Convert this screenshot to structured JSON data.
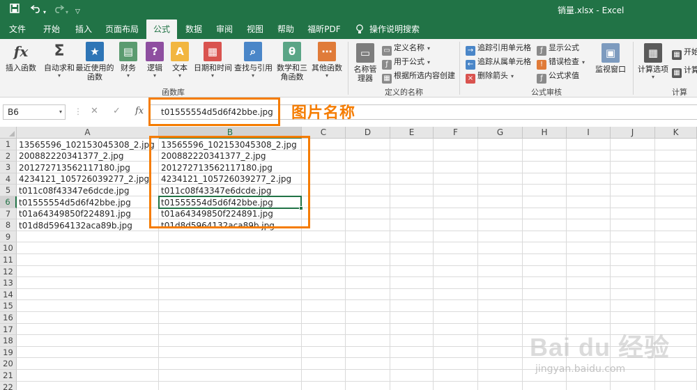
{
  "title_bar": {
    "document_title": "销量.xlsx  -  Excel",
    "save_icon": "save-icon",
    "undo_icon": "undo-icon",
    "redo_icon": "redo-icon",
    "customize_icon": "customize-toolbar-icon",
    "brand_color": "#217346"
  },
  "tabs": [
    {
      "label": "文件"
    },
    {
      "label": "开始"
    },
    {
      "label": "插入"
    },
    {
      "label": "页面布局"
    },
    {
      "label": "公式"
    },
    {
      "label": "数据"
    },
    {
      "label": "审阅"
    },
    {
      "label": "视图"
    },
    {
      "label": "帮助"
    },
    {
      "label": "福昕PDF"
    },
    {
      "label": "操作说明搜索"
    }
  ],
  "active_tab": "公式",
  "ribbon": {
    "function_library": {
      "label": "函数库",
      "buttons": [
        {
          "label": "插入函数",
          "icon": "fx-icon"
        },
        {
          "label": "自动求和",
          "icon": "sigma-icon"
        },
        {
          "label": "最近使用的函数",
          "icon": "star-book-icon"
        },
        {
          "label": "财务",
          "icon": "finance-book-icon"
        },
        {
          "label": "逻辑",
          "icon": "logic-book-icon"
        },
        {
          "label": "文本",
          "icon": "text-book-icon"
        },
        {
          "label": "日期和时间",
          "icon": "date-time-book-icon"
        },
        {
          "label": "查找与引用",
          "icon": "lookup-book-icon"
        },
        {
          "label": "数学和三角函数",
          "icon": "math-book-icon"
        },
        {
          "label": "其他函数",
          "icon": "more-functions-book-icon"
        }
      ]
    },
    "defined_names": {
      "label": "定义的名称",
      "name_manager": "名称管理器",
      "items": [
        {
          "label": "定义名称"
        },
        {
          "label": "用于公式"
        },
        {
          "label": "根据所选内容创建"
        }
      ]
    },
    "formula_auditing": {
      "label": "公式审核",
      "items": [
        {
          "label": "追踪引用单元格"
        },
        {
          "label": "显示公式"
        },
        {
          "label": "追踪从属单元格"
        },
        {
          "label": "错误检查"
        },
        {
          "label": "删除箭头"
        },
        {
          "label": "公式求值"
        }
      ],
      "watch_window": "监视窗口"
    },
    "calculation": {
      "label": "计算",
      "options": "计算选项",
      "calc_now": "开始",
      "calc_sheet": "计算"
    }
  },
  "formula_bar": {
    "name_box": "B6",
    "cancel_icon": "cancel-icon",
    "enter_icon": "enter-icon",
    "fx_label": "fx",
    "value": "t01555554d5d6f42bbe.jpg"
  },
  "annotation": {
    "text": "图片名称",
    "color": "#f57c00"
  },
  "sheet": {
    "columns": [
      "A",
      "B",
      "C",
      "D",
      "E",
      "F",
      "G",
      "H",
      "I",
      "J",
      "K"
    ],
    "rows": [
      "1",
      "2",
      "3",
      "4",
      "5",
      "6",
      "7",
      "8",
      "9",
      "10",
      "11",
      "12",
      "13",
      "14",
      "15",
      "16",
      "17",
      "18",
      "19",
      "20",
      "21",
      "22"
    ],
    "active_cell": "B6",
    "column_a": [
      "13565596_102153045308_2.jpg",
      "200882220341377_2.jpg",
      "201272713562117180.jpg",
      "4234121_105726039277_2.jpg",
      "t011c08f43347e6dcde.jpg",
      "t01555554d5d6f42bbe.jpg",
      "t01a64349850f224891.jpg",
      "t01d8d5964132aca89b.jpg"
    ],
    "column_b": [
      "13565596_102153045308_2.jpg",
      "200882220341377_2.jpg",
      "201272713562117180.jpg",
      "4234121_105726039277_2.jpg",
      "t011c08f43347e6dcde.jpg",
      "t01555554d5d6f42bbe.jpg",
      "t01a64349850f224891.jpg",
      "t01d8d5964132aca89b.jpg"
    ]
  },
  "watermark": {
    "logo": "Bai du 经验",
    "url": "jingyan.baidu.com"
  }
}
